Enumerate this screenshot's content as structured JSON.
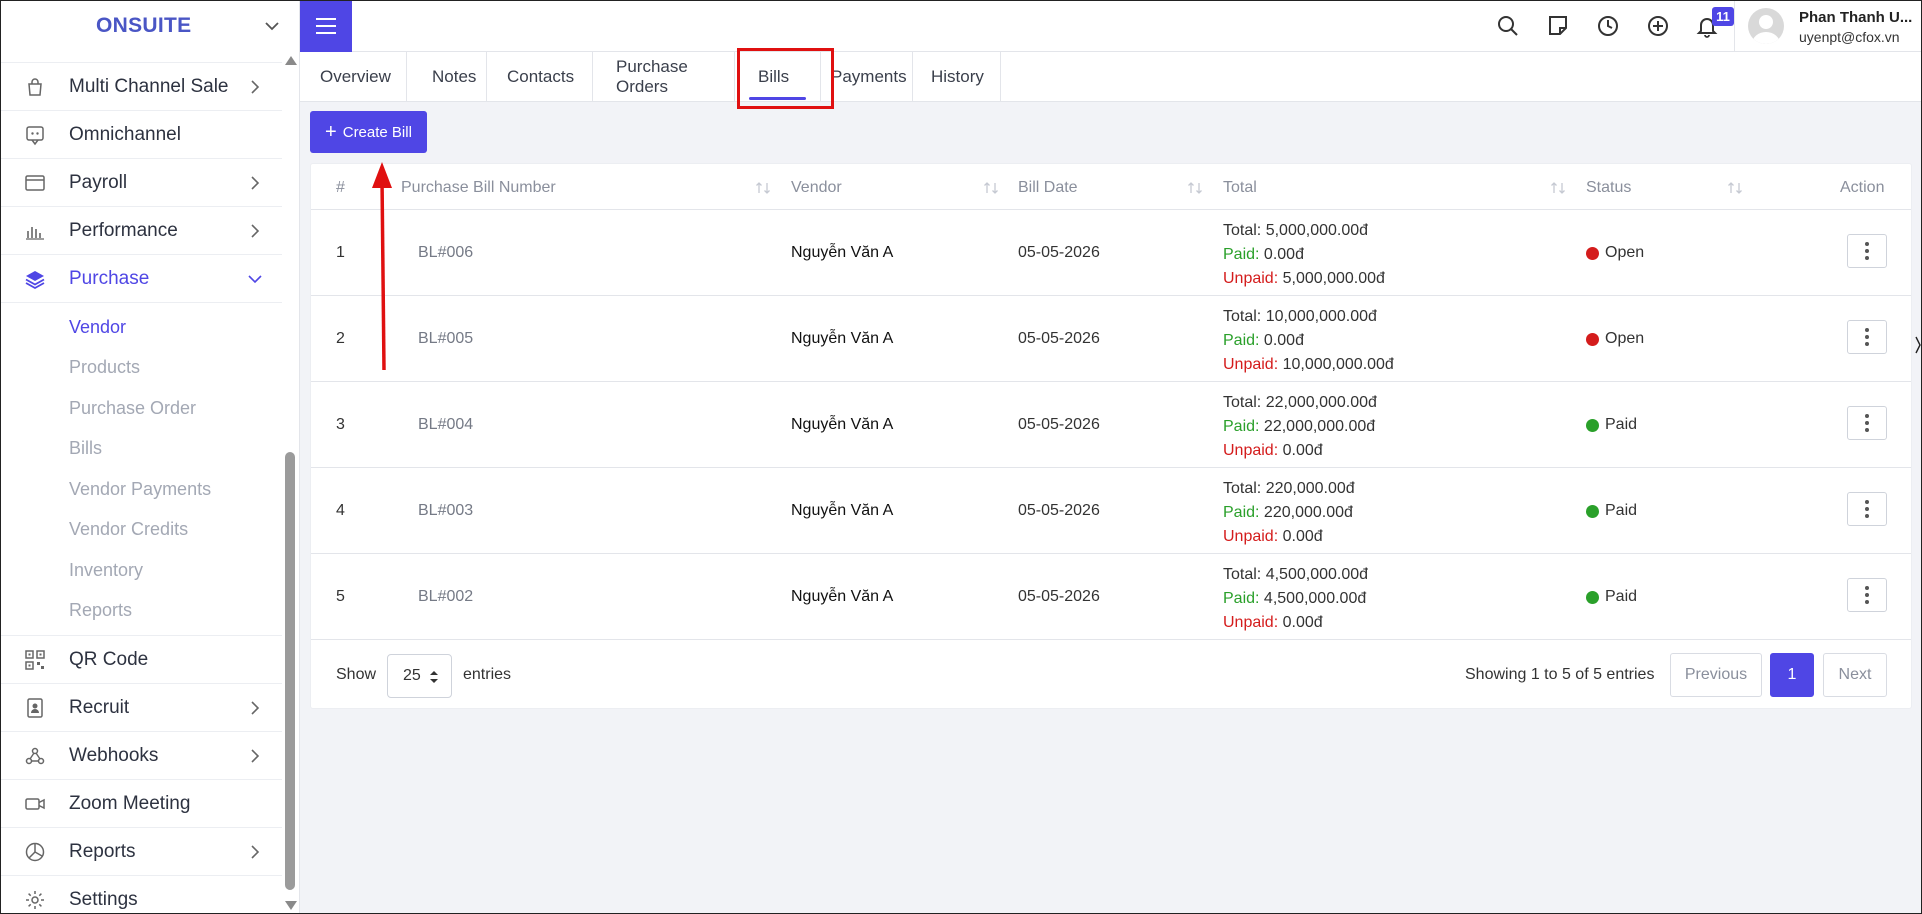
{
  "brand": {
    "name": "ONSUITE"
  },
  "sidebar": {
    "items": [
      {
        "label": "Multi Channel Sale",
        "icon": "bag-icon",
        "has_chevron": true
      },
      {
        "label": "Omnichannel",
        "icon": "chat-icon",
        "has_chevron": false
      },
      {
        "label": "Payroll",
        "icon": "card-icon",
        "has_chevron": true
      },
      {
        "label": "Performance",
        "icon": "bar-chart-icon",
        "has_chevron": true
      },
      {
        "label": "Purchase",
        "icon": "layers-icon",
        "has_chevron": true,
        "expanded": true
      }
    ],
    "purchase_sub": [
      "Vendor",
      "Products",
      "Purchase Order",
      "Bills",
      "Vendor Payments",
      "Vendor Credits",
      "Inventory",
      "Reports"
    ],
    "items_after": [
      {
        "label": "QR Code",
        "icon": "qr-code-icon",
        "has_chevron": false
      },
      {
        "label": "Recruit",
        "icon": "id-badge-icon",
        "has_chevron": true
      },
      {
        "label": "Webhooks",
        "icon": "webhook-icon",
        "has_chevron": true
      },
      {
        "label": "Zoom Meeting",
        "icon": "video-icon",
        "has_chevron": false
      },
      {
        "label": "Reports",
        "icon": "pie-chart-icon",
        "has_chevron": true
      },
      {
        "label": "Settings",
        "icon": "gear-icon",
        "has_chevron": false
      }
    ]
  },
  "topbar": {
    "notification_count": "11",
    "user_name": "Phan Thanh U...",
    "user_email": "uyenpt@cfox.vn"
  },
  "tabs": [
    "Overview",
    "Notes",
    "Contacts",
    "Purchase Orders",
    "Bills",
    "Payments",
    "History"
  ],
  "active_tab": "Bills",
  "create_button": "Create Bill",
  "table": {
    "headers": [
      "#",
      "Purchase Bill Number",
      "Vendor",
      "Bill Date",
      "Total",
      "Status",
      "Action"
    ],
    "labels": {
      "total": "Total:",
      "paid": "Paid:",
      "unpaid": "Unpaid:"
    },
    "rows": [
      {
        "num": "1",
        "bill": "BL#006",
        "vendor": "Nguyễn Văn A",
        "date": "05-05-2026",
        "total": "5,000,000.00đ",
        "paid": "0.00đ",
        "unpaid": "5,000,000.00đ",
        "status": "Open"
      },
      {
        "num": "2",
        "bill": "BL#005",
        "vendor": "Nguyễn Văn A",
        "date": "05-05-2026",
        "total": "10,000,000.00đ",
        "paid": "0.00đ",
        "unpaid": "10,000,000.00đ",
        "status": "Open"
      },
      {
        "num": "3",
        "bill": "BL#004",
        "vendor": "Nguyễn Văn A",
        "date": "05-05-2026",
        "total": "22,000,000.00đ",
        "paid": "22,000,000.00đ",
        "unpaid": "0.00đ",
        "status": "Paid"
      },
      {
        "num": "4",
        "bill": "BL#003",
        "vendor": "Nguyễn Văn A",
        "date": "05-05-2026",
        "total": "220,000.00đ",
        "paid": "220,000.00đ",
        "unpaid": "0.00đ",
        "status": "Paid"
      },
      {
        "num": "5",
        "bill": "BL#002",
        "vendor": "Nguyễn Văn A",
        "date": "05-05-2026",
        "total": "4,500,000.00đ",
        "paid": "4,500,000.00đ",
        "unpaid": "0.00đ",
        "status": "Paid"
      }
    ]
  },
  "footer": {
    "show_label": "Show",
    "page_size": "25",
    "entries_label": "entries",
    "info": "Showing 1 to 5 of 5 entries",
    "prev": "Previous",
    "current_page": "1",
    "next": "Next"
  },
  "colors": {
    "accent": "#4f46e5",
    "open_status": "#d41c1c",
    "paid_status": "#2aa02a",
    "annotation": "#e01010"
  }
}
